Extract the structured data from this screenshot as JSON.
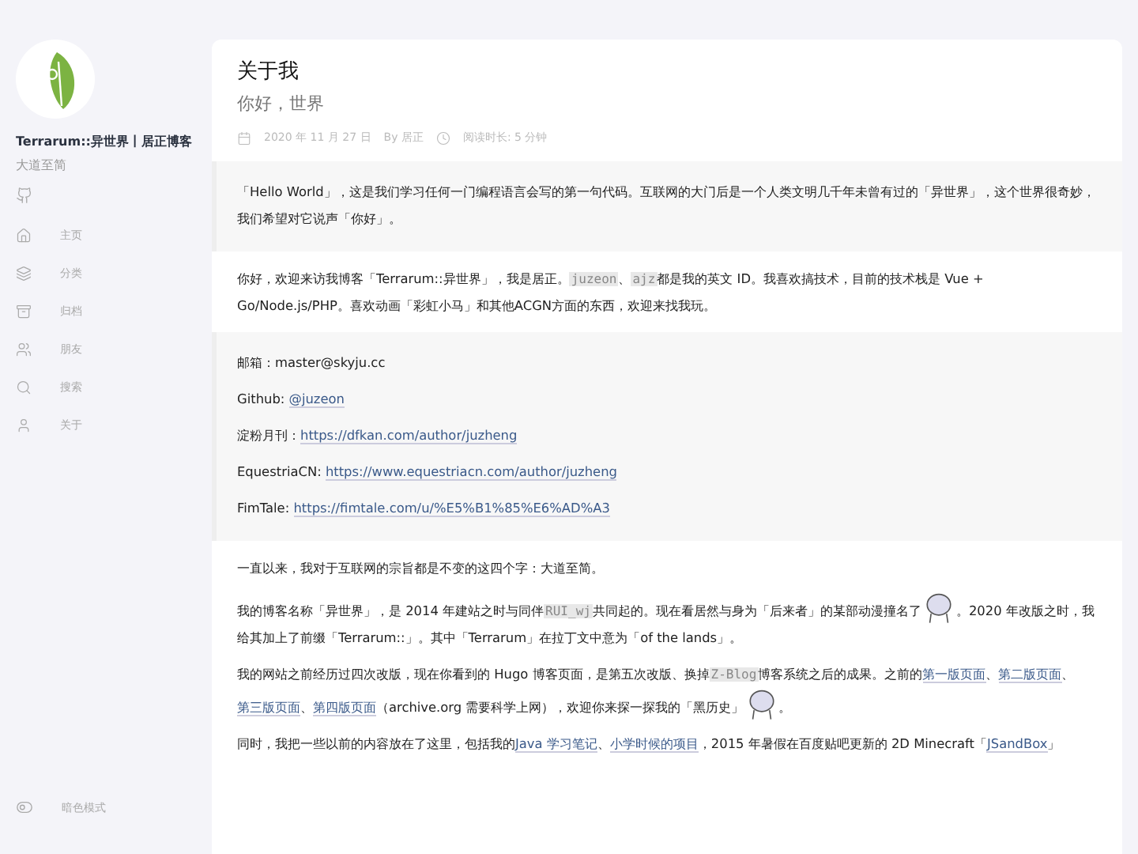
{
  "sidebar": {
    "site_title": "Terrarum::异世界丨居正博客",
    "tagline": "大道至简",
    "nav": [
      {
        "label": "主页",
        "kind": "home"
      },
      {
        "label": "分类",
        "kind": "layers"
      },
      {
        "label": "归档",
        "kind": "archive"
      },
      {
        "label": "朋友",
        "kind": "friends"
      },
      {
        "label": "搜索",
        "kind": "search"
      },
      {
        "label": "关于",
        "kind": "user"
      }
    ],
    "dark_mode": {
      "label": "暗色模式",
      "on": false
    }
  },
  "article": {
    "title": "关于我",
    "subtitle": "你好，世界",
    "date": "2020 年 11 月 27 日",
    "author": "By 居正",
    "read_time": "阅读时长: 5 分钟",
    "blocks": [
      {
        "kind": "quote",
        "paragraphs": [
          [
            {
              "kind": "text",
              "text": "「Hello World」，这是我们学习任何一门编程语言会写的第一句代码。互联网的大门后是一个人类文明几千年未曾有过的「异世界」，这个世界很奇妙，我们希望对它说声「你好」。"
            }
          ]
        ]
      },
      {
        "kind": "plain",
        "paragraphs": [
          [
            {
              "kind": "text",
              "text": "你好，欢迎来访我博客「Terrarum::异世界」，我是居正。"
            },
            {
              "kind": "code",
              "text": "juzeon"
            },
            {
              "kind": "text",
              "text": "、"
            },
            {
              "kind": "code",
              "text": "ajz"
            },
            {
              "kind": "text",
              "text": "都是我的英文 ID。我喜欢搞技术，目前的技术栈是 Vue + Go/Node.js/PHP。喜欢动画「彩虹小马」和其他ACGN方面的东西，欢迎来找我玩。"
            }
          ]
        ]
      },
      {
        "kind": "quote",
        "paragraphs": [
          [
            {
              "kind": "text",
              "text": "邮箱：master@skyju.cc"
            }
          ],
          [
            {
              "kind": "text",
              "text": "Github: "
            },
            {
              "kind": "link",
              "text": "@juzeon"
            }
          ],
          [
            {
              "kind": "text",
              "text": "淀粉月刊："
            },
            {
              "kind": "link",
              "text": "https://dfkan.com/author/juzheng"
            }
          ],
          [
            {
              "kind": "text",
              "text": "EquestriaCN: "
            },
            {
              "kind": "link",
              "text": "https://www.equestriacn.com/author/juzheng"
            }
          ],
          [
            {
              "kind": "text",
              "text": "FimTale: "
            },
            {
              "kind": "link",
              "text": "https://fimtale.com/u/%E5%B1%85%E6%AD%A3"
            }
          ]
        ]
      },
      {
        "kind": "plain",
        "paragraphs": [
          [
            {
              "kind": "text",
              "text": "一直以来，我对于互联网的宗旨都是不变的这四个字：大道至简。"
            }
          ],
          [
            {
              "kind": "text",
              "text": "我的博客名称「异世界」，是 2014 年建站之时与同伴"
            },
            {
              "kind": "code",
              "text": "RUI_wj"
            },
            {
              "kind": "text",
              "text": "共同起的。现在看居然与身为「后来者」的某部动漫撞名了"
            },
            {
              "kind": "sticker"
            },
            {
              "kind": "text",
              "text": "。2020 年改版之时，我给其加上了前缀「Terrarum::」。其中「Terrarum」在拉丁文中意为「of the lands」。"
            }
          ],
          [
            {
              "kind": "text",
              "text": "我的网站之前经历过四次改版，现在你看到的 Hugo 博客页面，是第五次改版、换掉"
            },
            {
              "kind": "code",
              "text": "Z-Blog"
            },
            {
              "kind": "text",
              "text": "博客系统之后的成果。之前的"
            },
            {
              "kind": "link",
              "text": "第一版页面"
            },
            {
              "kind": "text",
              "text": "、"
            },
            {
              "kind": "link",
              "text": "第二版页面"
            },
            {
              "kind": "text",
              "text": "、"
            },
            {
              "kind": "link",
              "text": "第三版页面"
            },
            {
              "kind": "text",
              "text": "、"
            },
            {
              "kind": "link",
              "text": "第四版页面"
            },
            {
              "kind": "text",
              "text": "（archive.org 需要科学上网），欢迎你来探一探我的「黑历史」"
            },
            {
              "kind": "sticker"
            },
            {
              "kind": "text",
              "text": "。"
            }
          ],
          [
            {
              "kind": "text",
              "text": "同时，我把一些以前的内容放在了这里，包括我的"
            },
            {
              "kind": "link",
              "text": "Java 学习笔记"
            },
            {
              "kind": "text",
              "text": "、"
            },
            {
              "kind": "link",
              "text": "小学时候的项目"
            },
            {
              "kind": "text",
              "text": "，2015 年暑假在百度贴吧更新的 2D Minecraft「"
            },
            {
              "kind": "link",
              "text": "JSandBox"
            },
            {
              "kind": "text",
              "text": "」"
            }
          ]
        ]
      }
    ]
  }
}
